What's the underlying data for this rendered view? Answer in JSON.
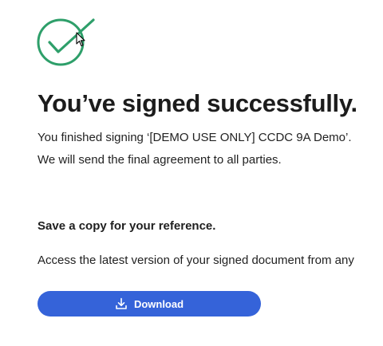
{
  "confirmation": {
    "title": "You’ve signed successfully.",
    "line1": "You finished signing ‘[DEMO USE ONLY] CCDC 9A Demo’.",
    "line2": "We will send the final agreement to all parties."
  },
  "save_section": {
    "heading": "Save a copy for your reference.",
    "description": "Access the latest version of your signed document from any"
  },
  "download_button": {
    "label": "Download",
    "icon": "download-icon"
  },
  "colors": {
    "success_green": "#2e9f6a",
    "button_blue": "#3563d9"
  }
}
